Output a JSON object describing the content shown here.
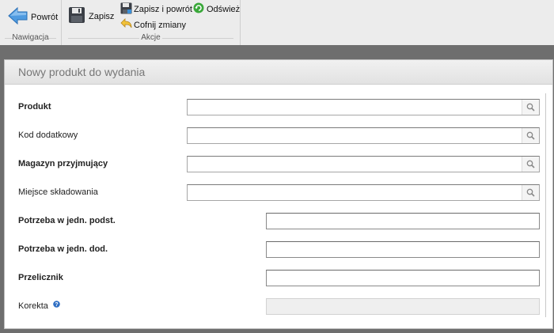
{
  "toolbar": {
    "nav_group_caption": "Nawigacja",
    "actions_group_caption": "Akcje",
    "back_label": "Powrót",
    "save_label": "Zapisz",
    "save_back_label": "Zapisz i powrót",
    "refresh_label": "Odśwież",
    "undo_label": "Cofnij zmiany"
  },
  "panel": {
    "title": "Nowy produkt do wydania"
  },
  "form": {
    "product": {
      "label": "Produkt",
      "value": ""
    },
    "extra_code": {
      "label": "Kod dodatkowy",
      "value": ""
    },
    "receiving_warehouse": {
      "label": "Magazyn przyjmujący",
      "value": ""
    },
    "storage_location": {
      "label": "Miejsce składowania",
      "value": ""
    },
    "need_base_unit": {
      "label": "Potrzeba w jedn. podst.",
      "value": ""
    },
    "need_extra_unit": {
      "label": "Potrzeba w jedn. dod.",
      "value": ""
    },
    "converter": {
      "label": "Przelicznik",
      "value": ""
    },
    "correction": {
      "label": "Korekta",
      "value": ""
    }
  },
  "icons": {
    "back": "arrow-left-icon",
    "save": "floppy-disk-icon",
    "save_back": "floppy-disk-small-icon",
    "refresh": "refresh-icon",
    "undo": "undo-icon",
    "lookup": "magnifier-icon",
    "help": "help-icon"
  },
  "colors": {
    "accent_blue": "#3a8fd8",
    "refresh_green": "#3aa83a",
    "undo_yellow": "#e6b422",
    "panel_title": "#777777"
  }
}
